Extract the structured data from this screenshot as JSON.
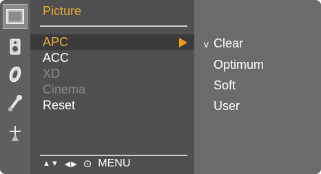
{
  "menu": {
    "title": "Picture",
    "items": [
      {
        "label": "APC",
        "state": "selected",
        "has_submenu": true
      },
      {
        "label": "ACC",
        "state": "normal"
      },
      {
        "label": "XD",
        "state": "disabled"
      },
      {
        "label": "Cinema",
        "state": "disabled"
      },
      {
        "label": "Reset",
        "state": "normal"
      }
    ]
  },
  "sidebar": {
    "icons": [
      {
        "name": "picture-icon",
        "active": true
      },
      {
        "name": "sound-icon",
        "active": false
      },
      {
        "name": "time-icon",
        "active": false
      },
      {
        "name": "option-icon",
        "active": false
      },
      {
        "name": "setup-icon",
        "active": false
      }
    ]
  },
  "options": {
    "check_mark": "v",
    "items": [
      "Clear",
      "Optimum",
      "Soft",
      "User"
    ],
    "checked": "Clear"
  },
  "nav_hint": {
    "updown": "▲▼",
    "leftright": "◀▶",
    "ok": "⊙",
    "menu_label": "MENU"
  },
  "colors": {
    "accent": "#e8a73a",
    "arrow": "#f29a1c",
    "panel": "#4f4f4f",
    "background": "#6b6b6b",
    "disabled_text": "#8a8a8a"
  }
}
